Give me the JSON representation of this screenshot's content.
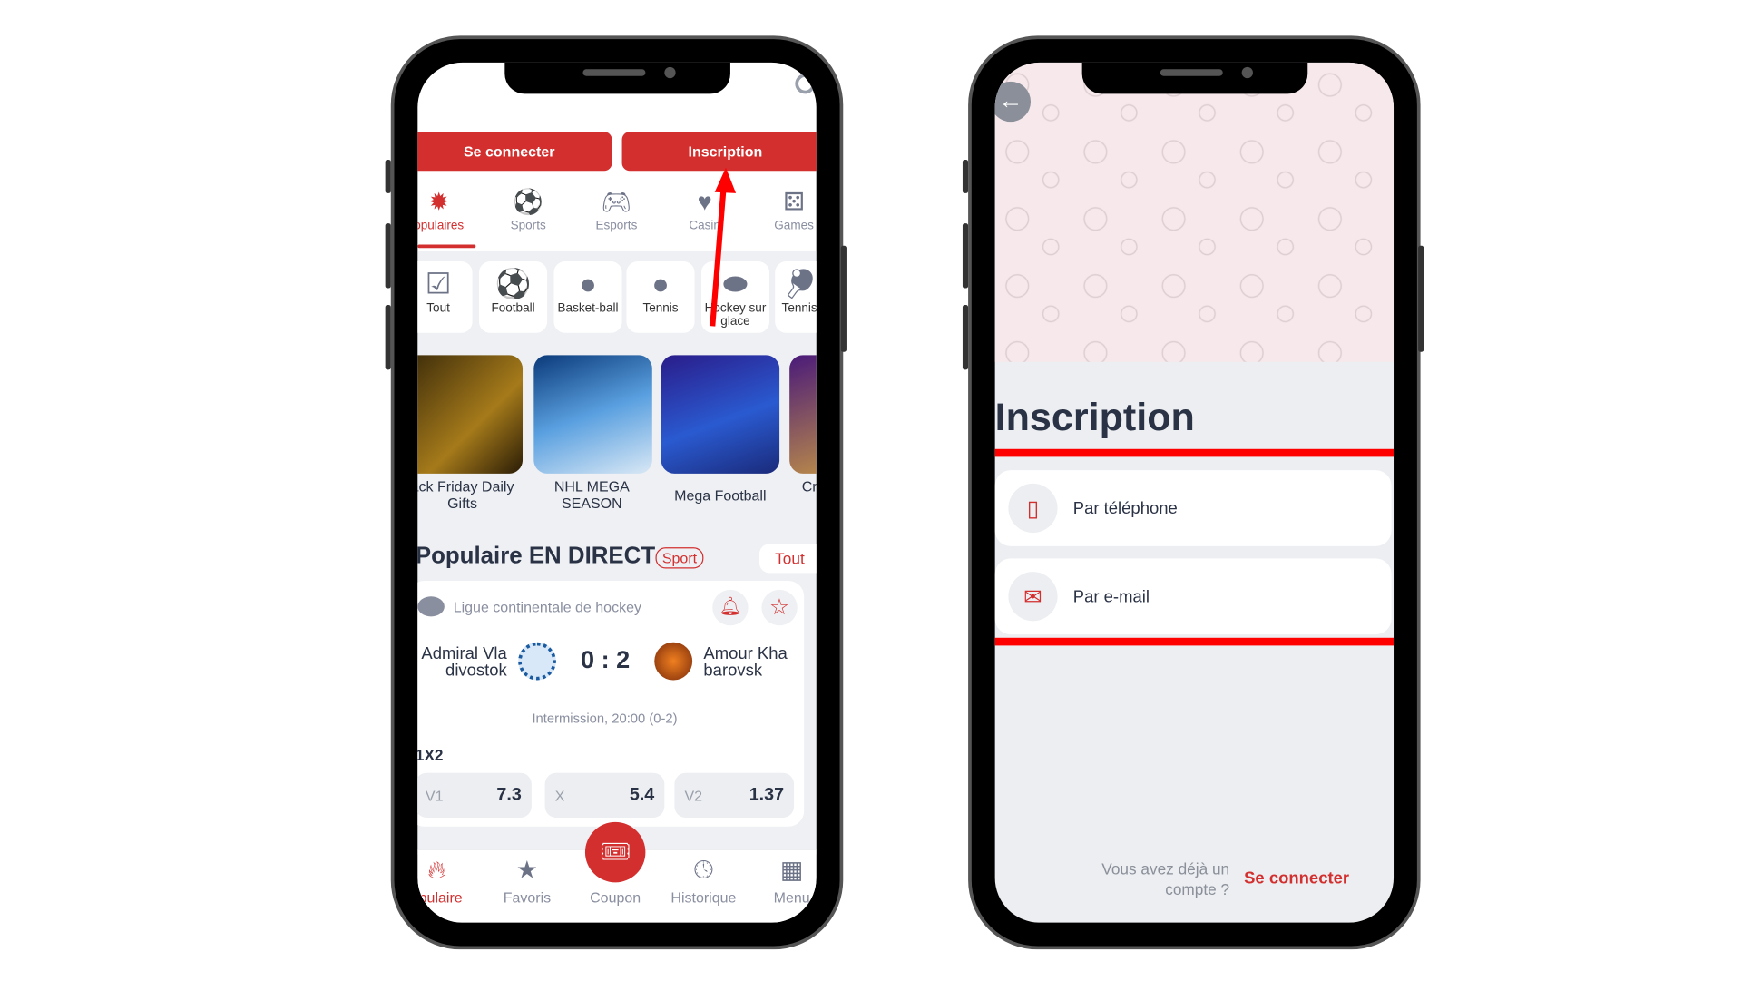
{
  "left_phone": {
    "auth": {
      "login": "Se connecter",
      "register": "Inscription"
    },
    "tabs": [
      {
        "label": "opulaires",
        "icon": "badge-star-icon",
        "active": true
      },
      {
        "label": "Sports",
        "icon": "sports-ball-icon"
      },
      {
        "label": "Esports",
        "icon": "gamepad-icon"
      },
      {
        "label": "Casin",
        "icon": "cards-icon"
      },
      {
        "label": "Games",
        "icon": "dice-icon"
      }
    ],
    "sports": [
      {
        "label": "Tout",
        "icon": "check-stack-icon"
      },
      {
        "label": "Football",
        "icon": "football-icon"
      },
      {
        "label": "Basket-ball",
        "icon": "basketball-icon"
      },
      {
        "label": "Tennis",
        "icon": "tennis-icon"
      },
      {
        "label": "Hockey sur glace",
        "icon": "hockey-puck-icon"
      },
      {
        "label": "Tennis tabl",
        "icon": "ping-pong-icon"
      }
    ],
    "banners": [
      {
        "label": "ack Friday Daily Gifts"
      },
      {
        "label": "NHL MEGA SEASON"
      },
      {
        "label": "Mega Football"
      },
      {
        "label": "Cr"
      }
    ],
    "live": {
      "title": "Populaire EN DIRECT",
      "badge": "Sport",
      "all": "Tout",
      "league": "Ligue continentale de hockey",
      "home": "Admiral Vla divostok",
      "away": "Amour Kha barovsk",
      "score": "0 : 2",
      "status": "Intermission, 20:00 (0-2)",
      "market": "1X2",
      "odds": [
        {
          "label": "V1",
          "value": "7.3"
        },
        {
          "label": "X",
          "value": "5.4"
        },
        {
          "label": "V2",
          "value": "1.37"
        }
      ]
    },
    "nav": [
      {
        "label": "opulaire",
        "icon": "flame-icon",
        "active": true
      },
      {
        "label": "Favoris",
        "icon": "star-icon"
      },
      {
        "label": "Coupon",
        "icon": "ticket-icon"
      },
      {
        "label": "Historique",
        "icon": "clock-icon"
      },
      {
        "label": "Menu",
        "icon": "grid-icon"
      }
    ]
  },
  "right_phone": {
    "title": "Inscription",
    "options": [
      {
        "label": "Par téléphone",
        "icon": "phone-icon"
      },
      {
        "label": "Par e-mail",
        "icon": "envelope-icon"
      }
    ],
    "footer_text": "Vous avez déjà un compte ?",
    "footer_link": "Se connecter"
  },
  "colors": {
    "brand": "#d32f2f",
    "annotation": "#ff0000",
    "text": "#2a3245"
  }
}
